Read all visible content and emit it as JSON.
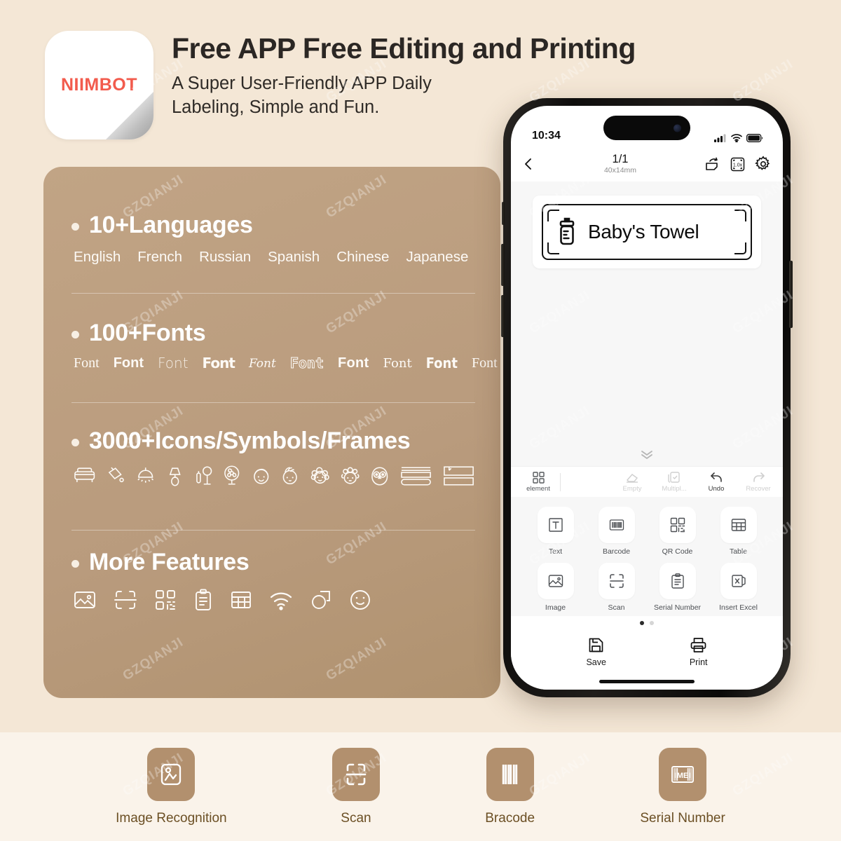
{
  "header": {
    "logo_text": "NIIMBOT",
    "title": "Free APP Free Editing and Printing",
    "subtitle_line1": "A Super User-Friendly APP Daily",
    "subtitle_line2": "Labeling, Simple and Fun."
  },
  "watermark": {
    "text": "GZQIANJI"
  },
  "features": [
    {
      "heading": "10+Languages",
      "items": [
        "English",
        "French",
        "Russian",
        "Spanish",
        "Chinese",
        "Japanese"
      ]
    },
    {
      "heading": "100+Fonts",
      "samples": [
        "Font",
        "Font",
        "Font",
        "Font",
        "Font",
        "Font",
        "Font",
        "Font",
        "Font",
        "Font"
      ]
    },
    {
      "heading": "3000+Icons/Symbols/Frames",
      "icons": [
        "sofa-icon",
        "paint-bucket-icon",
        "pendant-lamp-icon",
        "table-lamp-icon",
        "vanity-mirror-icon",
        "fan-icon",
        "boy-face-icon",
        "girl-face-icon",
        "curly-hair-face-icon",
        "sheep-face-icon",
        "owl-icon",
        "frame-lines-icon",
        "frame-box-icon"
      ]
    },
    {
      "heading": "More Features",
      "icons": [
        "image-icon",
        "scan-icon",
        "qr-code-icon",
        "clipboard-list-icon",
        "table-icon",
        "wifi-icon",
        "shapes-icon",
        "smiley-icon"
      ]
    }
  ],
  "phone": {
    "status": {
      "time": "10:34",
      "signal": "signal-icon",
      "wifi": "wifi-icon",
      "battery": "battery-icon"
    },
    "nav": {
      "back": "chevron-left-icon",
      "title": "1/1",
      "subtitle": "40x14mm",
      "icons": [
        "rotate-label-icon",
        "zoom-1x-icon",
        "gear-icon"
      ],
      "zoom_level": "1.0x"
    },
    "canvas": {
      "label_text": "Baby's Towel",
      "label_icon": "baby-bottle-icon",
      "collapse": "chevron-double-down-icon"
    },
    "toolstrip": {
      "element_label": "element",
      "actions": [
        {
          "label": "Empty",
          "icon": "eraser-icon",
          "enabled": false
        },
        {
          "label": "Multipl...",
          "icon": "multi-select-icon",
          "enabled": false
        },
        {
          "label": "Undo",
          "icon": "undo-icon",
          "enabled": true
        },
        {
          "label": "Recover",
          "icon": "redo-icon",
          "enabled": false
        }
      ]
    },
    "tools": [
      {
        "label": "Text",
        "icon": "text-icon"
      },
      {
        "label": "Barcode",
        "icon": "barcode-icon"
      },
      {
        "label": "QR Code",
        "icon": "qr-code-icon"
      },
      {
        "label": "Table",
        "icon": "table-icon"
      },
      {
        "label": "Image",
        "icon": "image-icon"
      },
      {
        "label": "Scan",
        "icon": "scan-icon"
      },
      {
        "label": "Serial Number",
        "icon": "serial-number-icon"
      },
      {
        "label": "Insert Excel",
        "icon": "excel-icon"
      }
    ],
    "pager": {
      "pages": 2,
      "active": 0
    },
    "bottom": [
      {
        "label": "Save",
        "icon": "save-icon"
      },
      {
        "label": "Print",
        "icon": "printer-icon"
      }
    ]
  },
  "strip": [
    {
      "label": "Image Recognition",
      "icon": "image-recognition-icon"
    },
    {
      "label": "Scan",
      "icon": "scan-icon"
    },
    {
      "label": "Bracode",
      "icon": "barcode-icon"
    },
    {
      "label": "Serial Number",
      "icon": "imei-icon"
    }
  ],
  "colors": {
    "page_background": "#f4e7d6",
    "card_background": "#bd9f80",
    "strip_background": "#faf3ea",
    "brand_red": "#f25b4d",
    "strip_icon": "#b2906e",
    "strip_label": "#6b4f24"
  }
}
